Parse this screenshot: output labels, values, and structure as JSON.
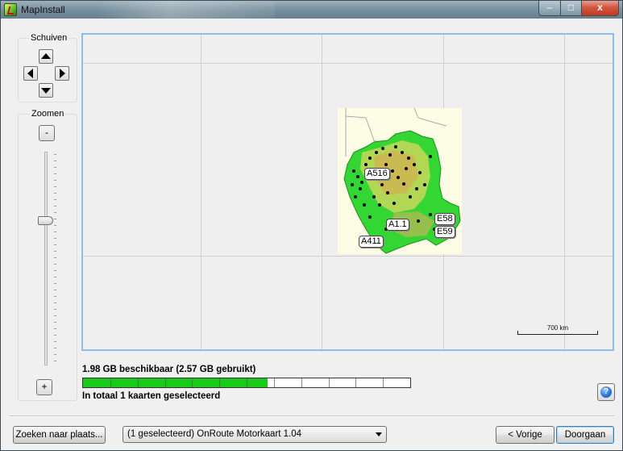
{
  "window": {
    "title": "MapInstall",
    "minimize_label": "–",
    "maximize_label": "□",
    "close_label": "x"
  },
  "pan": {
    "label": "Schuiven"
  },
  "zoom": {
    "label": "Zoomen",
    "minus_label": "-",
    "plus_label": "+",
    "level_fraction": 0.32
  },
  "map": {
    "road_labels": [
      "A516",
      "A1.1",
      "E58",
      "E59",
      "A411"
    ],
    "scale_label": "700 km",
    "colors": {
      "land": "#fdfde6",
      "coverage_green": "#33d633",
      "accent_orange": "#e0a050",
      "border": "#8fbde8"
    }
  },
  "storage": {
    "available_text": "1.98 GB beschikbaar (2.57 GB gebruikt)",
    "used_fraction": 0.565,
    "selected_text": "In totaal 1 kaarten geselecteerd"
  },
  "footer": {
    "search_button": "Zoeken naar plaats...",
    "map_select_value": "(1 geselecteerd) OnRoute Motorkaart 1.04",
    "back_button": "< Vorige",
    "next_button": "Doorgaan",
    "help_icon": "?"
  }
}
